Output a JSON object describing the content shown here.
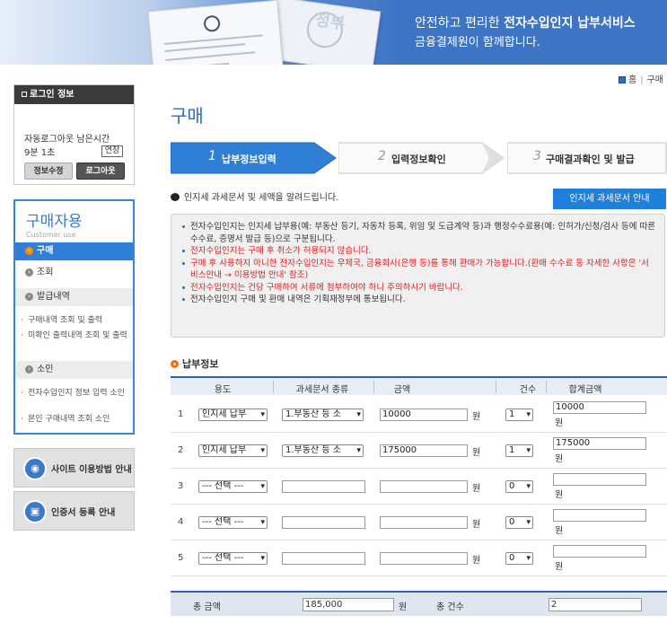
{
  "header": {
    "title_prefix": "안전하고 편리한 ",
    "title_bold": "전자수입인지 납부서비스",
    "subtitle": "금융결제원이 함께합니다.",
    "doc_gov_text": "정부"
  },
  "breadcrumb": {
    "home": "홈",
    "current": "구매"
  },
  "login": {
    "title": "로그인 정보",
    "auto_logout_label": "자동로그아웃 남은시간",
    "timer": "9분 1초",
    "extend_label": "연장",
    "info_button": "정보수정",
    "logout_button": "로그아웃"
  },
  "menu": {
    "title": "구매자용",
    "subtitle": "Customer use",
    "items": [
      {
        "label": "구매"
      },
      {
        "label": "조회"
      },
      {
        "label": "발급내역"
      },
      {
        "label": "소인"
      }
    ],
    "issuance_sub": [
      "구매내역 조회 및 출력",
      "미확인 출력내역 조회 및 출력"
    ],
    "cancel_sub": [
      "전자수입인지 정보 입력 소인",
      "본인 구매내역 조회 소인"
    ]
  },
  "banners": {
    "usage_guide": "사이트 이용방법 안내",
    "cert_guide": "인증서 등록 안내"
  },
  "page_title": "구매",
  "steps": [
    {
      "num": "1",
      "label": "납부정보입력"
    },
    {
      "num": "2",
      "label": "입력정보확인"
    },
    {
      "num": "3",
      "label": "구매결과확인 및 발급"
    }
  ],
  "notice": "인지세 과세문서 및 세액을 알려드립니다.",
  "tax_button": "인지세 과세문서 안내",
  "info_lines": [
    {
      "text": "전자수입인지는 인지세 납부용(예: 부동산 등기, 자동차 등록, 위임 및 도급계약 등)과 행정수수료용(예: 인허가/신청/검사 등에 따른 수수료, 증명서 발급 등)으로 구분됩니다.",
      "red": false
    },
    {
      "text": "전자수입인지는 구매 후 취소가 허용되지 않습니다.",
      "red": true
    },
    {
      "text": "구매 후 사용하지 아니한 전자수입인지는 우체국, 금융회사(은행 등)를 통해 환매가 가능합니다.(환매 수수료 등 자세한 사항은 '서비스안내 → 이용방법 안내' 참조)",
      "red": true
    },
    {
      "text": "전자수입인지는 건당 구매하여 서류에 첨부하여야 하니 주의하시기 바랍니다.",
      "red": true
    },
    {
      "text": "전자수입인지 구매 및 환매 내역은 기획재정부에 통보됩니다.",
      "red": false
    }
  ],
  "section_title": "납부정보",
  "table": {
    "headers": [
      "용도",
      "과세문서 종류",
      "금액",
      "건수",
      "합계금액"
    ],
    "unit": "원",
    "rows": [
      {
        "no": "1",
        "purpose": "인지세 납부",
        "doc_type": "1.부동산 등 소",
        "amount": "10000",
        "count": "1",
        "total": "10000"
      },
      {
        "no": "2",
        "purpose": "인지세 납부",
        "doc_type": "1.부동산 등 소",
        "amount": "175000",
        "count": "1",
        "total": "175000"
      },
      {
        "no": "3",
        "purpose": "--- 선택 ---",
        "doc_type": "",
        "amount": "",
        "count": "0",
        "total": ""
      },
      {
        "no": "4",
        "purpose": "--- 선택 ---",
        "doc_type": "",
        "amount": "",
        "count": "0",
        "total": ""
      },
      {
        "no": "5",
        "purpose": "--- 선택 ---",
        "doc_type": "",
        "amount": "",
        "count": "0",
        "total": ""
      }
    ]
  },
  "totals": {
    "amount_label": "총 금액",
    "amount": "185,000",
    "unit": "원",
    "count_label": "총 건수",
    "count": "2"
  }
}
